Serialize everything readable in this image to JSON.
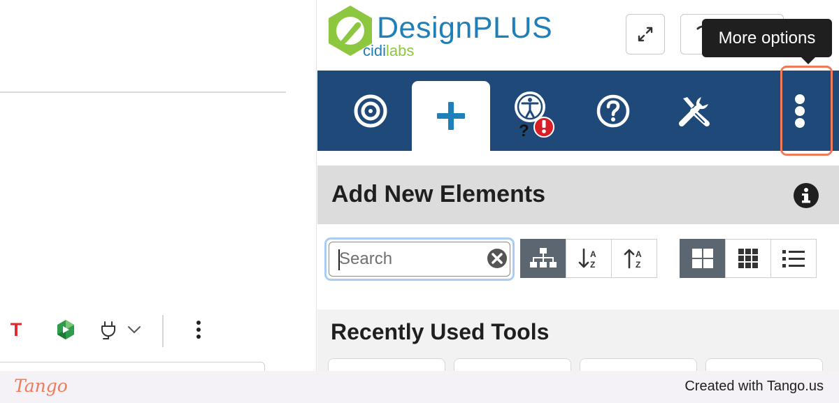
{
  "app": {
    "brand": "DesignPLUS",
    "brand_sub_a": "cidi",
    "brand_sub_b": "labs"
  },
  "colors": {
    "tabbar": "#1f4978",
    "accent_blue": "#1f7fb8",
    "logo_green": "#8dc63f",
    "highlight": "#ef7b59",
    "alert_red": "#e3262d"
  },
  "header": {
    "tooltip": "More options",
    "buttons": [
      {
        "name": "expand",
        "icon": "expand-arrows-icon"
      },
      {
        "name": "refresh",
        "icon": "refresh-icon"
      }
    ]
  },
  "tabs": [
    {
      "name": "target",
      "icon": "target-icon",
      "active": false
    },
    {
      "name": "add",
      "icon": "plus-icon",
      "active": true
    },
    {
      "name": "accessibility",
      "icon": "accessibility-icon",
      "badge": "!",
      "badge_prefix": "?",
      "active": false
    },
    {
      "name": "help",
      "icon": "question-circle-icon",
      "active": false
    },
    {
      "name": "tools",
      "icon": "wrench-screwdriver-icon",
      "active": false
    },
    {
      "name": "more",
      "icon": "vertical-ellipsis-icon",
      "active": false
    }
  ],
  "section": {
    "title": "Add New Elements",
    "info_icon": "info-circle-icon"
  },
  "search": {
    "placeholder": "Search",
    "value": ""
  },
  "sort_buttons": [
    {
      "name": "hierarchy",
      "icon": "sitemap-icon",
      "on": true
    },
    {
      "name": "sort-asc",
      "icon": "sort-alpha-down-icon",
      "on": false
    },
    {
      "name": "sort-desc",
      "icon": "sort-alpha-up-icon",
      "on": false
    }
  ],
  "view_buttons": [
    {
      "name": "large-grid",
      "icon": "large-grid-icon",
      "on": true
    },
    {
      "name": "small-grid",
      "icon": "small-grid-icon",
      "on": false
    },
    {
      "name": "list",
      "icon": "list-icon",
      "on": false
    }
  ],
  "recent": {
    "title": "Recently Used Tools"
  },
  "left_toolbar": {
    "t_label": "T",
    "icons": [
      "text-color-icon",
      "green-app-icon",
      "plug-icon",
      "chevron-down-icon",
      "vertical-ellipsis-icon"
    ]
  },
  "footer": {
    "logo": "Tango",
    "credit": "Created with Tango.us"
  }
}
